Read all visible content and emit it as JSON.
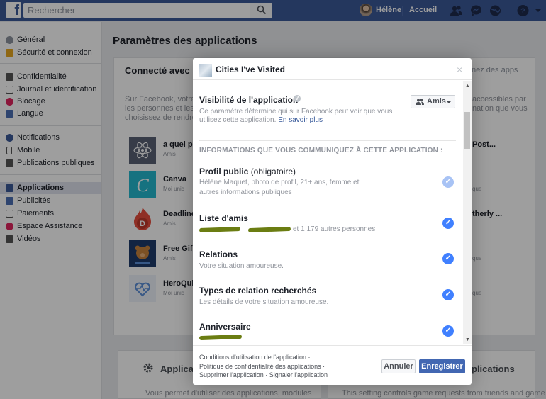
{
  "topbar": {
    "logo": "f",
    "search_placeholder": "Rechercher",
    "user_name": "Hélène",
    "home_label": "Accueil",
    "icons": [
      "friends-icon",
      "messages-icon",
      "notifications-icon",
      "help-icon",
      "menu-icon"
    ]
  },
  "sidebar": {
    "items": [
      {
        "label": "Général",
        "icon": "gear-icon"
      },
      {
        "label": "Sécurité et connexion",
        "icon": "shield-icon"
      },
      {
        "label": "Confidentialité",
        "icon": "lock-icon"
      },
      {
        "label": "Journal et identification",
        "icon": "timeline-icon"
      },
      {
        "label": "Blocage",
        "icon": "block-icon"
      },
      {
        "label": "Langue",
        "icon": "language-icon"
      },
      {
        "label": "Notifications",
        "icon": "globe-icon"
      },
      {
        "label": "Mobile",
        "icon": "mobile-icon"
      },
      {
        "label": "Publications publiques",
        "icon": "rss-icon"
      },
      {
        "label": "Applications",
        "icon": "apps-icon"
      },
      {
        "label": "Publicités",
        "icon": "ads-icon"
      },
      {
        "label": "Paiements",
        "icon": "card-icon"
      },
      {
        "label": "Espace Assistance",
        "icon": "support-icon"
      },
      {
        "label": "Vidéos",
        "icon": "video-icon"
      }
    ],
    "active_index": 9
  },
  "main": {
    "title": "Paramètres des applications",
    "connected_title": "Connecté avec Fac",
    "search_apps": "nez des apps",
    "desc_left": [
      "Sur Facebook, votre no",
      "les personnes et les ap",
      "choisissez de rendre pu"
    ],
    "desc_right": [
      "accessibles par",
      "nation que vous"
    ],
    "apps": [
      {
        "name": "a quel po",
        "meta": "Amis"
      },
      {
        "name": "Canva",
        "meta": "Moi unic"
      },
      {
        "name": "Deadline",
        "meta": "Amis"
      },
      {
        "name": "Free Gifts",
        "meta": "Amis"
      },
      {
        "name": "HeroQuiz",
        "meta": "Moi unic"
      }
    ],
    "right_apps": [
      {
        "name": "Post...",
        "meta": ""
      },
      {
        "name": "",
        "meta": "que"
      },
      {
        "name": "therly ...",
        "meta": ""
      },
      {
        "name": "",
        "meta": "que"
      },
      {
        "name": "",
        "meta": "que"
      }
    ],
    "bottom_left_title": "Applicat",
    "bottom_left_desc": "Vous permet d'utiliser des applications, modules",
    "bottom_right_title": "plications",
    "bottom_right_desc": "This setting controls game requests from friends and game"
  },
  "modal": {
    "title": "Cities I've Visited",
    "close": "×",
    "visibility_title": "Visibilité de l'application",
    "visibility_desc": "Ce paramètre détermine qui sur Facebook peut voir que vous utilisez cette application.",
    "learn_more": "En savoir plus",
    "audience": "Amis",
    "info_heading": "INFORMATIONS QUE VOUS COMMUNIQUEZ À CETTE APPLICATION :",
    "permissions": [
      {
        "title": "Profil public",
        "suffix": "(obligatoire)",
        "desc": "Hélène Maquet, photo de profil, 21+ ans, femme et autres informations publiques",
        "checked": true
      },
      {
        "title": "Liste d'amis",
        "suffix": "",
        "desc": "et 1 179 autres personnes",
        "checked": true
      },
      {
        "title": "Relations",
        "suffix": "",
        "desc": "Votre situation amoureuse.",
        "checked": true
      },
      {
        "title": "Types de relation recherchés",
        "suffix": "",
        "desc": "Les détails de votre situation amoureuse.",
        "checked": true
      },
      {
        "title": "Anniversaire",
        "suffix": "",
        "desc": "",
        "checked": true
      }
    ],
    "footer_links": [
      "Conditions d'utilisation de l'application",
      "Politique de confidentialité des applications",
      "Supprimer l'application",
      "Signaler l'application"
    ],
    "cancel_label": "Annuler",
    "save_label": "Enregistrer"
  },
  "colors": {
    "brand": "#3b5998",
    "accent": "#4267b2",
    "check": "#4080ff"
  }
}
